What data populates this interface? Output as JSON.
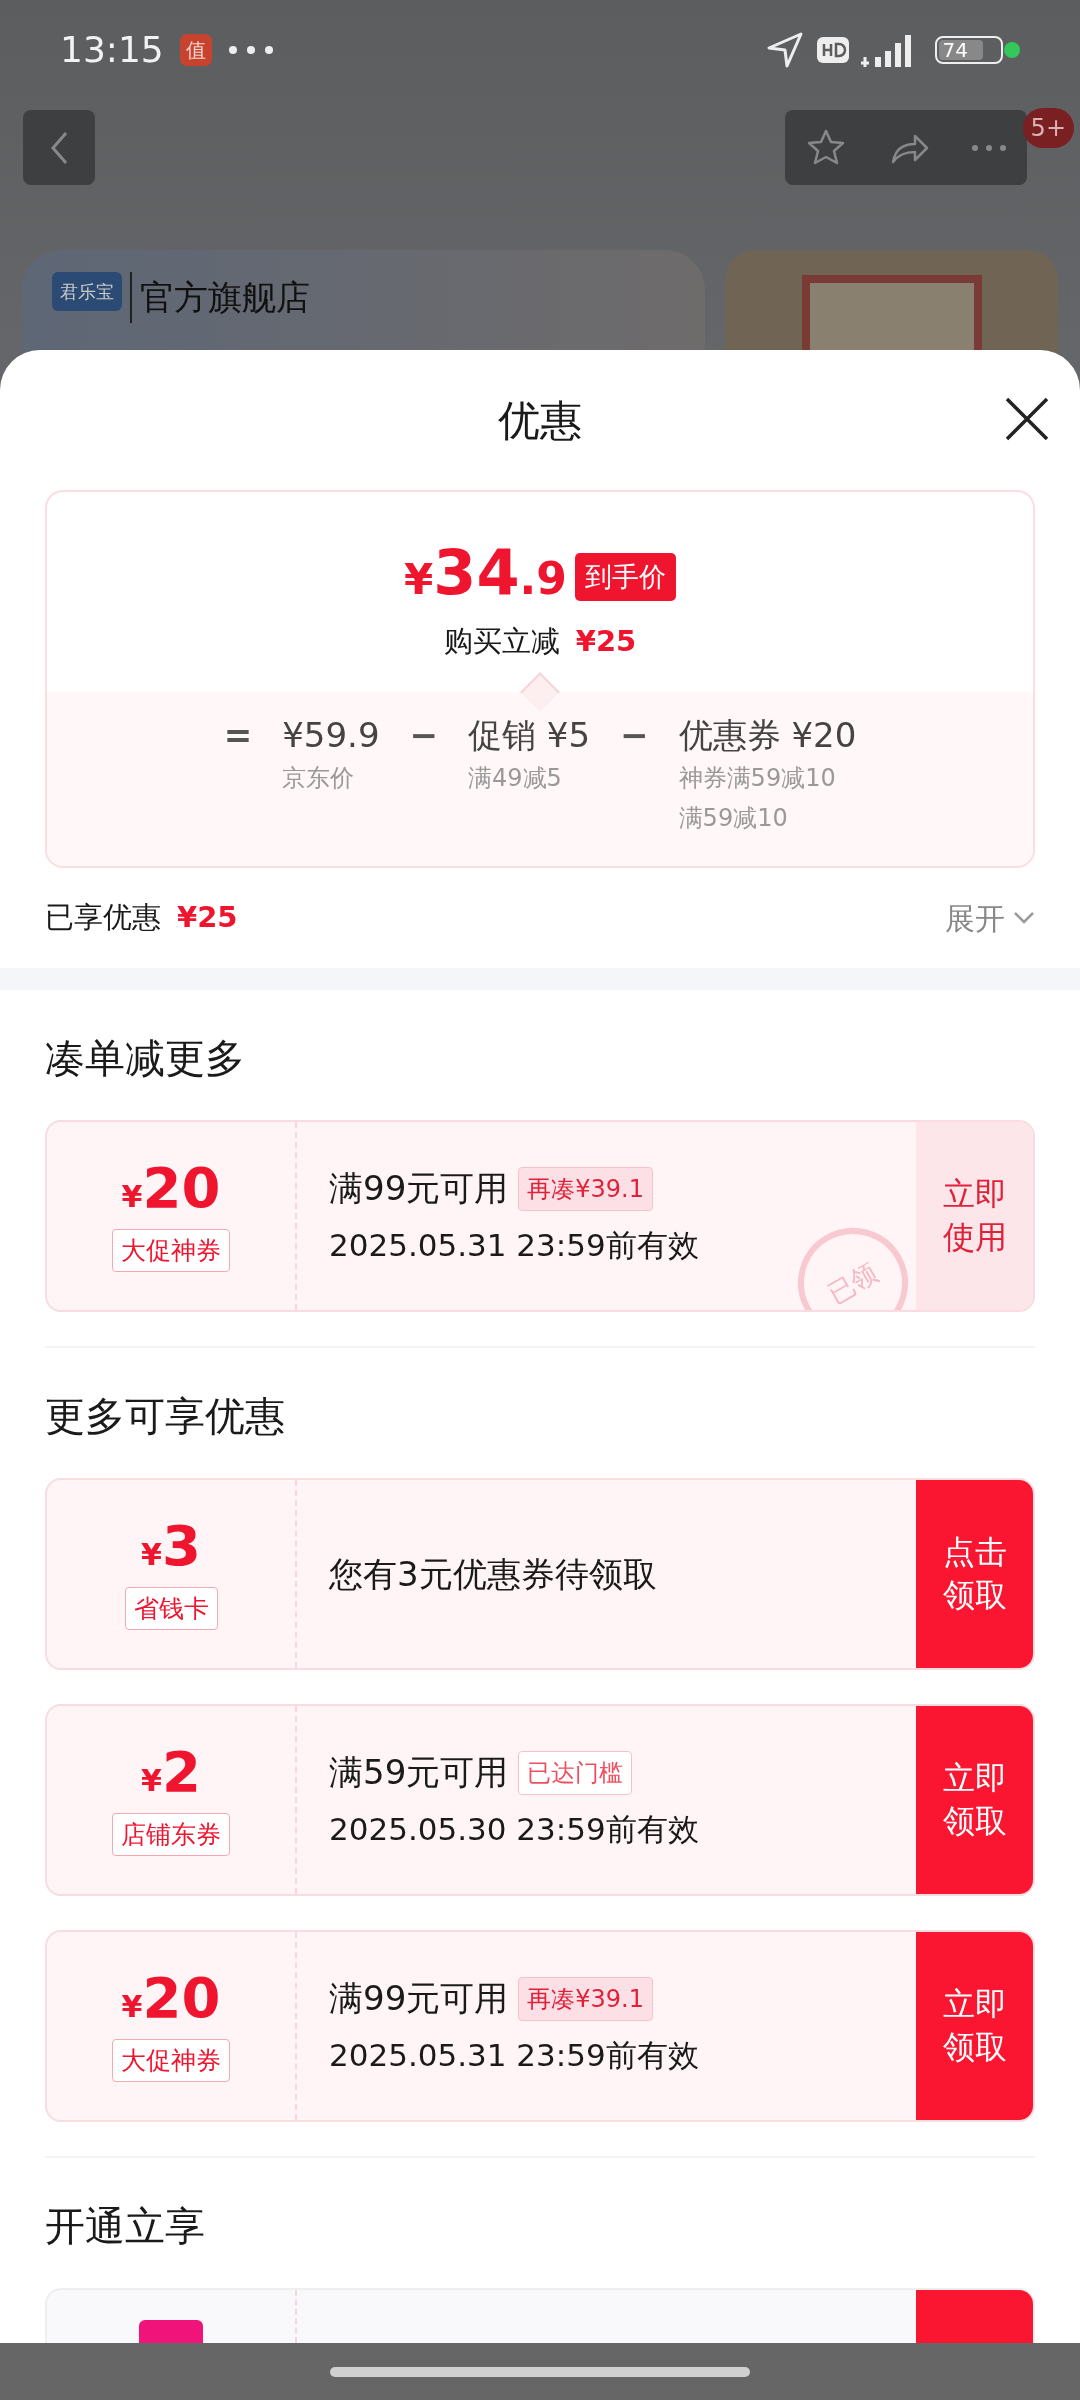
{
  "status_bar": {
    "time": "13:15",
    "app_badge": "值",
    "battery": "74"
  },
  "background_page": {
    "notification_count": "5+",
    "store_brand": "君乐宝",
    "store_label": "官方旗舰店"
  },
  "sheet": {
    "title": "优惠"
  },
  "price_summary": {
    "currency": "¥",
    "price_int": "34",
    "price_dec": ".9",
    "price_label": "到手价",
    "saving_label": "购买立减",
    "saving_amount": "¥25",
    "terms": [
      {
        "operator": "=",
        "amount": "¥59.9",
        "notes": [
          "京东价"
        ]
      },
      {
        "operator": "−",
        "amount": "促销 ¥5",
        "notes": [
          "满49减5"
        ]
      },
      {
        "operator": "−",
        "amount": "优惠券 ¥20",
        "notes": [
          "神券满59减10",
          "满59减10"
        ]
      }
    ]
  },
  "enjoyed": {
    "label": "已享优惠",
    "amount": "¥25",
    "toggle": "展开",
    "expanded": false
  },
  "sections": [
    {
      "heading": "凑单减更多",
      "coupons": [
        {
          "kind": "coupon",
          "currency": "¥",
          "amount": "20",
          "type": "大促神券",
          "condition": "满99元可用",
          "badge": {
            "text": "再凑¥39.1",
            "kind": "shortfall"
          },
          "validity": "2025.05.31 23:59前有效",
          "action": "立即使用",
          "claimed": true,
          "stamp": "已领"
        }
      ]
    },
    {
      "heading": "更多可享优惠",
      "coupons": [
        {
          "kind": "notice",
          "currency": "¥",
          "amount": "3",
          "type": "省钱卡",
          "message": "您有3元优惠券待领取",
          "action": "点击领取",
          "claimed": false
        },
        {
          "kind": "coupon",
          "currency": "¥",
          "amount": "2",
          "type": "店铺东券",
          "condition": "满59元可用",
          "badge": {
            "text": "已达门槛",
            "kind": "reached"
          },
          "validity": "2025.05.30 23:59前有效",
          "action": "立即领取",
          "claimed": false
        },
        {
          "kind": "coupon",
          "currency": "¥",
          "amount": "20",
          "type": "大促神券",
          "condition": "满99元可用",
          "badge": {
            "text": "再凑¥39.1",
            "kind": "shortfall"
          },
          "validity": "2025.05.31 23:59前有效",
          "action": "立即领取",
          "claimed": false
        }
      ]
    },
    {
      "heading": "开通立享",
      "coupons": [
        {
          "kind": "partial"
        }
      ]
    }
  ]
}
